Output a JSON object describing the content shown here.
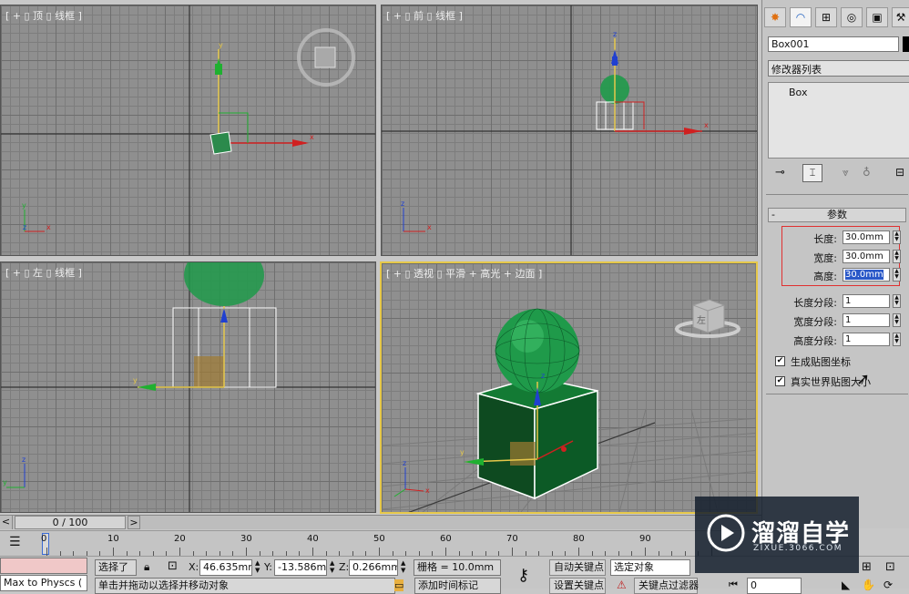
{
  "viewports": {
    "top": {
      "label": "[ + ▯ 顶 ▯ 线框 ]"
    },
    "front": {
      "label": "[ + ▯ 前 ▯ 线框 ]"
    },
    "left": {
      "label": "[ + ▯ 左 ▯ 线框 ]"
    },
    "perspective": {
      "label": "[ + ▯ 透视 ▯ 平滑 + 高光 + 边面 ]",
      "viewcube_face": "左"
    },
    "axis": {
      "x": "x",
      "y": "y",
      "z": "z"
    }
  },
  "command_panel": {
    "object_name": "Box001",
    "modifier_list": "修改器列表",
    "stack_item": "Box",
    "rollout_title": "参数",
    "rollout_toggle": "-",
    "params": [
      {
        "label": "长度:",
        "value": "30.0mm"
      },
      {
        "label": "宽度:",
        "value": "30.0mm"
      },
      {
        "label": "高度:",
        "value": "30.0mm"
      }
    ],
    "segments": [
      {
        "label": "长度分段:",
        "value": "1"
      },
      {
        "label": "宽度分段:",
        "value": "1"
      },
      {
        "label": "高度分段:",
        "value": "1"
      }
    ],
    "checks": [
      {
        "label": "生成贴图坐标",
        "checked": true
      },
      {
        "label": "真实世界贴图大小",
        "checked": true
      }
    ]
  },
  "timeline": {
    "frame_counter": "0 / 100",
    "prev": "<",
    "next": ">",
    "ticks": [
      "0",
      "10",
      "20",
      "30",
      "40",
      "50",
      "60",
      "70",
      "80",
      "90"
    ]
  },
  "status": {
    "script_listener": "Max to Physcs (",
    "selection": "选择了",
    "x_label": "X:",
    "x_value": "46.635mm",
    "y_label": "Y:",
    "y_value": "-13.586mm",
    "z_label": "Z:",
    "z_value": "0.266mm",
    "grid": "栅格 = 10.0mm",
    "auto_key": "自动关键点",
    "selected_object": "选定对象",
    "set_key": "设置关键点",
    "key_filter": "关键点过滤器",
    "add_time_tag": "添加时间标记",
    "prompt": "单击并拖动以选择并移动对象",
    "frame": "0"
  },
  "watermark": {
    "name": "溜溜自学",
    "url": "ZIXUE.3066.COM"
  },
  "colors": {
    "viewport_bg": "#8f8f8f",
    "active_border": "#e6c84a",
    "sphere": "#1f9a4a",
    "box": "#0e5a26",
    "axis_x": "#d02020",
    "axis_y": "#1fb030",
    "axis_z": "#2040d0",
    "highlight_red": "#e03030"
  }
}
